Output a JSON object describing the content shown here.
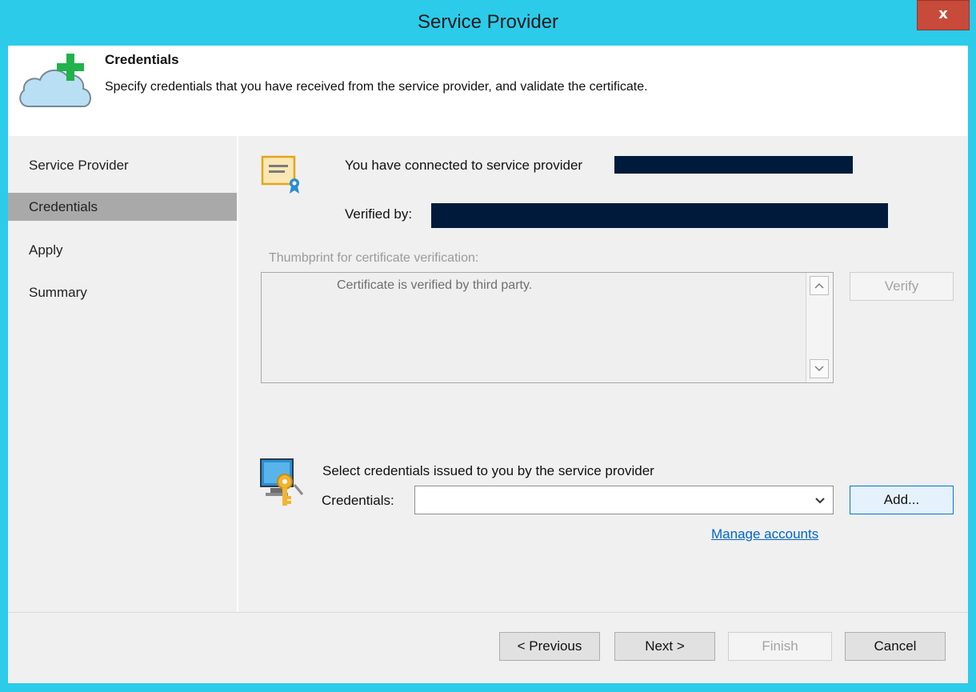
{
  "window": {
    "title": "Service Provider",
    "close_label": "x"
  },
  "header": {
    "title": "Credentials",
    "description": "Specify credentials that you have received from the service provider, and validate the certificate."
  },
  "sidebar": {
    "items": [
      {
        "label": "Service Provider",
        "active": false
      },
      {
        "label": "Credentials",
        "active": true
      },
      {
        "label": "Apply",
        "active": false
      },
      {
        "label": "Summary",
        "active": false
      }
    ]
  },
  "main": {
    "connected_text": "You have connected to service provider",
    "verified_by_label": "Verified by:",
    "thumbprint_label": "Thumbprint for certificate verification:",
    "thumbprint_value": "Certificate is verified by third party.",
    "verify_button": "Verify",
    "select_credentials_text": "Select credentials issued to you by the service provider",
    "credentials_label": "Credentials:",
    "credentials_value": "",
    "add_button": "Add...",
    "manage_accounts_link": "Manage accounts"
  },
  "footer": {
    "previous_button": "< Previous",
    "next_button": "Next >",
    "finish_button": "Finish",
    "cancel_button": "Cancel"
  },
  "colors": {
    "title_bar": "#2ccbea",
    "close_button": "#c74a3a",
    "active_nav": "#a9a9a9",
    "link": "#0066cc",
    "redaction": "#001a3c",
    "icon_plus": "#21b24b"
  },
  "icons": [
    "cloud-plus-icon",
    "certificate-icon",
    "credentials-key-icon",
    "chevron-up-icon",
    "chevron-down-icon",
    "dropdown-caret-icon",
    "close-icon"
  ]
}
